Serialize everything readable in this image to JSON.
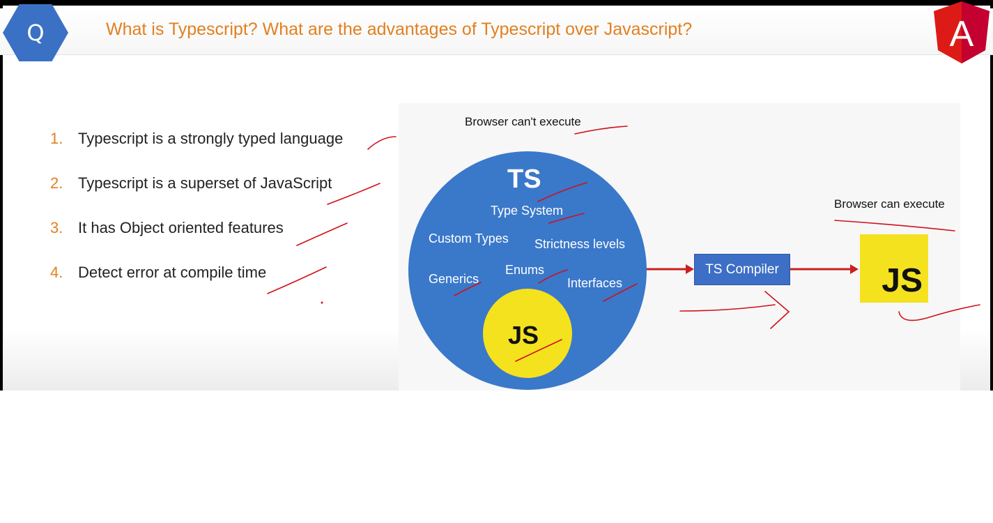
{
  "header": {
    "badge": "Q",
    "question": "What is Typescript? What are the advantages of Typescript over Javascript?",
    "logo_letter": "A"
  },
  "points": [
    {
      "num": "1.",
      "text": "Typescript is a strongly typed language"
    },
    {
      "num": "2.",
      "text": "Typescript is a superset of JavaScript"
    },
    {
      "num": "3.",
      "text": "It has Object oriented features"
    },
    {
      "num": "4.",
      "text": "Detect error at compile time"
    }
  ],
  "diagram": {
    "browser_cant": "Browser can't execute",
    "browser_can": "Browser can execute",
    "circle": {
      "title": "TS",
      "features": [
        "Type System",
        "Custom Types",
        "Strictness levels",
        "Generics",
        "Enums",
        "Interfaces"
      ],
      "inner": "JS"
    },
    "compiler": "TS Compiler",
    "output": "JS"
  },
  "colors": {
    "accent_orange": "#e28021",
    "badge_blue": "#3b71c4",
    "circle_blue": "#3a78ca",
    "js_yellow": "#f4e21e",
    "arrow_red": "#cc1f1f",
    "angular_red": "#dd1b16",
    "annotation_red": "#d0101a"
  }
}
